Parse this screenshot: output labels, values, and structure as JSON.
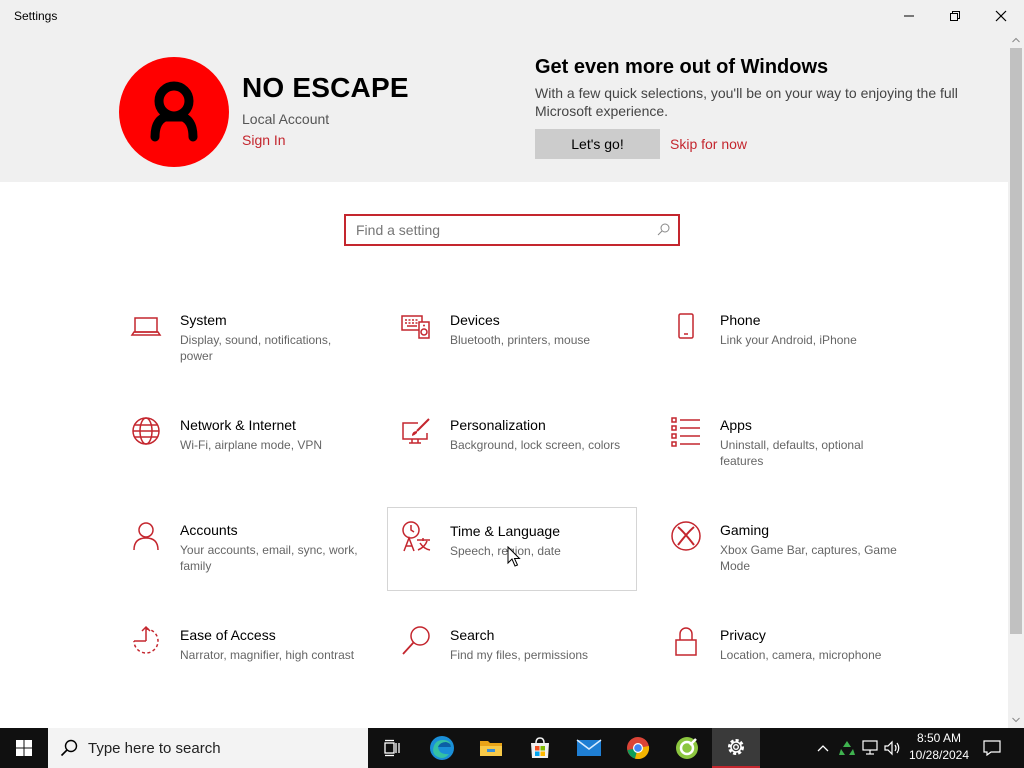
{
  "window": {
    "title": "Settings"
  },
  "account": {
    "name": "NO ESCAPE",
    "type": "Local Account",
    "sign_in": "Sign In"
  },
  "promo": {
    "title": "Get even more out of Windows",
    "description": "With a few quick selections, you'll be on your way to enjoying the full Microsoft experience.",
    "primary_button": "Let's go!",
    "skip_link": "Skip for now"
  },
  "search": {
    "placeholder": "Find a setting",
    "value": ""
  },
  "tiles": [
    {
      "name": "System",
      "desc": "Display, sound, notifications, power",
      "icon": "laptop-icon"
    },
    {
      "name": "Devices",
      "desc": "Bluetooth, printers, mouse",
      "icon": "keyboard-speaker-icon"
    },
    {
      "name": "Phone",
      "desc": "Link your Android, iPhone",
      "icon": "phone-icon"
    },
    {
      "name": "Network & Internet",
      "desc": "Wi-Fi, airplane mode, VPN",
      "icon": "globe-icon"
    },
    {
      "name": "Personalization",
      "desc": "Background, lock screen, colors",
      "icon": "paint-brush-icon"
    },
    {
      "name": "Apps",
      "desc": "Uninstall, defaults, optional features",
      "icon": "app-list-icon"
    },
    {
      "name": "Accounts",
      "desc": "Your accounts, email, sync, work, family",
      "icon": "person-icon"
    },
    {
      "name": "Time & Language",
      "desc": "Speech, region, date",
      "icon": "time-language-icon"
    },
    {
      "name": "Gaming",
      "desc": "Xbox Game Bar, captures, Game Mode",
      "icon": "xbox-icon"
    },
    {
      "name": "Ease of Access",
      "desc": "Narrator, magnifier, high contrast",
      "icon": "ease-of-access-icon"
    },
    {
      "name": "Search",
      "desc": "Find my files, permissions",
      "icon": "magnifier-icon"
    },
    {
      "name": "Privacy",
      "desc": "Location, camera, microphone",
      "icon": "lock-icon"
    }
  ],
  "taskbar": {
    "search_placeholder": "Type here to search",
    "apps": [
      "task-view-icon",
      "edge-icon",
      "file-explorer-icon",
      "store-icon",
      "mail-icon",
      "chrome-icon",
      "app-icon",
      "settings-gear-icon"
    ],
    "clock_time": "8:50 AM",
    "clock_date": "10/28/2024"
  },
  "colors": {
    "accent": "#c4262e",
    "avatar": "#ff0000",
    "header_bg": "#f0f0f0",
    "taskbar": "#101010"
  }
}
